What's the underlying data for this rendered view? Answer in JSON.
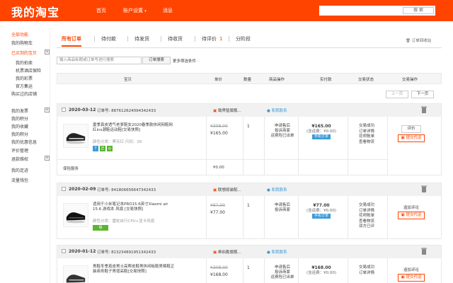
{
  "header": {
    "brand": "我的淘宝",
    "nav": [
      "首页",
      "账户设置",
      "消息"
    ],
    "search_button": "搜 索"
  },
  "sidebar": {
    "items": [
      {
        "label": "全部功能",
        "red": true,
        "sub": false,
        "plus": false
      },
      {
        "label": "我的购物车",
        "red": false,
        "sub": false,
        "plus": false
      },
      {
        "label": "已买到的宝贝",
        "red": true,
        "sub": false,
        "plus": true
      },
      {
        "label": "我的拍卖",
        "red": false,
        "sub": true,
        "plus": false
      },
      {
        "label": "机票酒店保险",
        "red": false,
        "sub": true,
        "plus": false
      },
      {
        "label": "我的彩票",
        "red": false,
        "sub": true,
        "plus": false
      },
      {
        "label": "官方集运",
        "red": false,
        "sub": true,
        "plus": false
      },
      {
        "label": "购买过的店铺",
        "red": false,
        "sub": false,
        "plus": false
      },
      {
        "label": "我的发票",
        "red": false,
        "sub": false,
        "plus": true
      },
      {
        "label": "我的积分",
        "red": false,
        "sub": false,
        "plus": false
      },
      {
        "label": "我的收藏",
        "red": false,
        "sub": false,
        "plus": false
      },
      {
        "label": "我的积分",
        "red": false,
        "sub": false,
        "plus": false
      },
      {
        "label": "我的优惠信息",
        "red": false,
        "sub": false,
        "plus": false
      },
      {
        "label": "评价管理",
        "red": false,
        "sub": false,
        "plus": false
      },
      {
        "label": "退款维权",
        "red": false,
        "sub": false,
        "plus": true
      },
      {
        "label": "我的足迹",
        "red": false,
        "sub": false,
        "plus": false
      },
      {
        "label": "流量钱包",
        "red": false,
        "sub": false,
        "plus": false
      }
    ]
  },
  "tabs": [
    {
      "label": "所有订单",
      "count": ""
    },
    {
      "label": "待付款",
      "count": ""
    },
    {
      "label": "待发货",
      "count": ""
    },
    {
      "label": "待收货",
      "count": ""
    },
    {
      "label": "待评价",
      "count": "1"
    },
    {
      "label": "分阶段",
      "count": ""
    }
  ],
  "recycle_label": "订单回收站",
  "order_search": {
    "placeholder": "输入商品标题或订单号进行搜索",
    "button": "订单搜索",
    "more": "更多筛选条件 ·"
  },
  "table_header": [
    "宝贝",
    "单价",
    "数量",
    "商品操作",
    "实付款",
    "交易状态",
    "交易操作"
  ],
  "pager": {
    "prev": "上一页",
    "next": "下一页"
  },
  "orders": [
    {
      "date": "2020-03-12",
      "order_no_label": "订单号:",
      "order_no": "887612624094342433",
      "shop": "致界智旗舰...",
      "contact": "和我联系",
      "product": "夏季真皮透气老爹鞋女2020春季款休闲网鞋网红ins潮鞋运动鞋[交易快照]",
      "attr": "颜色分类：黑灰红  尺码：39",
      "orig_price": "¥308.00",
      "price": "¥165.00",
      "qty": "1",
      "ops": [
        "申请售后",
        "投诉商家",
        "运费险已出单"
      ],
      "paid": "¥165.00",
      "paid_note": "(含运费：¥0.00)",
      "pay_badge": "手机订单",
      "status": [
        "交易成功",
        "订单详情",
        "花呗账单",
        "查看物流"
      ],
      "act1": "评价",
      "act2": "提交代运",
      "service": "保险服务",
      "service_price": "¥0.00"
    },
    {
      "date": "2020-02-09",
      "order_no_label": "订单号:",
      "order_no": "841806656647342433",
      "shop": "联想原装配...",
      "contact": "和我联系",
      "product": "适用于小米笔记本PRO15.6英寸Xiaomi air 15.6 游戏本 风扇 [交易快照]",
      "attr": "颜色分类：雷蛇自行CPU+显卡风扇",
      "orig_price": "¥87.00",
      "price": "¥77.00",
      "qty": "1",
      "ops": [
        "申请售后",
        "投诉商家"
      ],
      "paid": "¥77.00",
      "paid_note": "(含运费：¥0.00)",
      "pay_badge": "手机订单",
      "status": [
        "交易成功",
        "订单详情",
        "花呗账单",
        "查看物流",
        "双方已评"
      ],
      "act1": "追加评论",
      "act2": "提交代运",
      "service": "",
      "service_price": ""
    },
    {
      "date": "2020-01-12",
      "order_no_label": "订单号:",
      "order_no": "813234891951342433",
      "shop": "希伯勒旗舰...",
      "contact": "和我联系",
      "product": "男鞋冬季真皮男士高帮皮鞋男休闲板鞋男棉鞋正装商务鞋子男增高鞋[交易快照]",
      "attr": "",
      "orig_price": "¥308.00",
      "price": "¥168.00",
      "qty": "1",
      "ops": [
        "申请售后",
        "投诉商家",
        "运费险已出单"
      ],
      "paid": "¥168.00",
      "paid_note": "(含运费：¥0.00)",
      "pay_badge": "",
      "status": [
        "交易成功",
        "订单详情"
      ],
      "act1": "追加评论",
      "act2": "提交代运",
      "service": "",
      "service_price": ""
    }
  ]
}
